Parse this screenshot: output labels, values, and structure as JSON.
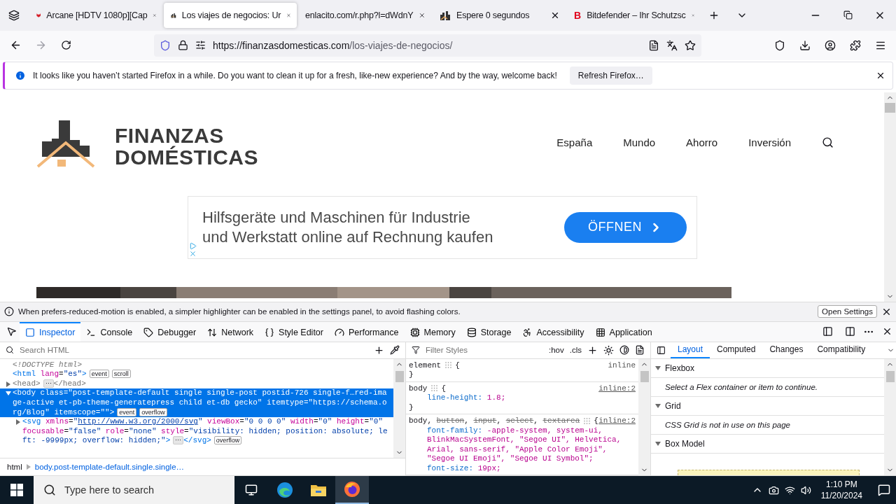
{
  "browser": {
    "tabs": [
      {
        "title": "Arcane [HDTV 1080p][Cap",
        "kind": "cat",
        "selected": false
      },
      {
        "title": "Los viajes de negocios: Ur",
        "kind": "buildings",
        "selected": true
      },
      {
        "title": "enlacito.com/r.php?l=dWdnY",
        "kind": "none",
        "selected": false
      },
      {
        "title": "Espere 0 segundos",
        "kind": "buildings",
        "selected": false
      },
      {
        "title": "Bitdefender – Ihr Schutzsc",
        "kind": "letter",
        "letter": "B",
        "selected": false
      }
    ],
    "url_host": "https://finanzasdomesticas.com",
    "url_path": "/los-viajes-de-negocios/",
    "notification": {
      "message": "It looks like you haven’t started Firefox in a while. Do you want to clean it up for a fresh, like-new experience? And by the way, welcome back!",
      "button": "Refresh Firefox…"
    }
  },
  "page": {
    "logo": [
      "FINANZAS",
      "DOMÉSTICAS"
    ],
    "menu": [
      "España",
      "Mundo",
      "Ahorro",
      "Inversión"
    ],
    "ad": {
      "lines": [
        "Hilfsgeräte und Maschinen für Industrie",
        "und Werkstatt online auf Rechnung kaufen"
      ],
      "button": "ÖFFNEN"
    }
  },
  "devtools": {
    "notice": {
      "message": "When prefers-reduced-motion is enabled, a simpler highlighter can be enabled in the settings panel, to avoid flashing colors.",
      "button": "Open Settings"
    },
    "tools": [
      {
        "label": "Inspector",
        "selected": true
      },
      {
        "label": "Console",
        "selected": false
      },
      {
        "label": "Debugger",
        "selected": false
      },
      {
        "label": "Network",
        "selected": false
      },
      {
        "label": "Style Editor",
        "selected": false
      },
      {
        "label": "Performance",
        "selected": false
      },
      {
        "label": "Memory",
        "selected": false
      },
      {
        "label": "Storage",
        "selected": false
      },
      {
        "label": "Accessibility",
        "selected": false
      },
      {
        "label": "Application",
        "selected": false
      }
    ],
    "html": {
      "placeholder": "Search HTML",
      "lines": [
        {
          "kind": "leaf",
          "selected": false,
          "segments": [
            {
              "kind": "doctype",
              "text": "<!DOCTYPE html>"
            }
          ]
        },
        {
          "kind": "leaf",
          "selected": false,
          "segments": [
            {
              "kind": "tag",
              "text": "<html"
            },
            {
              "kind": "attr",
              "text": " lang"
            },
            {
              "kind": "punct",
              "text": "="
            },
            {
              "kind": "value",
              "text": "\"es\""
            },
            {
              "kind": "tag",
              "text": ">"
            },
            {
              "kind": "badge",
              "text": "event"
            },
            {
              "kind": "badge",
              "text": "scroll"
            }
          ]
        },
        {
          "kind": "node",
          "expanded": false,
          "selected": false,
          "segments": [
            {
              "kind": "dim",
              "text": "<head>"
            },
            {
              "kind": "more",
              "text": "⋯"
            },
            {
              "kind": "dim",
              "text": "</head>"
            }
          ]
        },
        {
          "kind": "node",
          "expanded": true,
          "selected": true,
          "segments": [
            {
              "kind": "tag",
              "text": "<body"
            },
            {
              "kind": "attr",
              "text": " class"
            },
            {
              "kind": "punct",
              "text": "="
            },
            {
              "kind": "value",
              "text": "\"post-template-default single single-post postid-726 single-f…red-image-active et-pb-theme-generatepress child et-db gecko\""
            },
            {
              "kind": "attr",
              "text": " itemtype"
            },
            {
              "kind": "punct",
              "text": "="
            },
            {
              "kind": "value",
              "text": "\"https://schema.org/Blog\""
            },
            {
              "kind": "attr",
              "text": " itemscope"
            },
            {
              "kind": "punct",
              "text": "="
            },
            {
              "kind": "value",
              "text": "\"\""
            },
            {
              "kind": "tag",
              "text": ">"
            },
            {
              "kind": "badge",
              "text": "event"
            },
            {
              "kind": "badge",
              "text": "overflow"
            }
          ],
          "children": [
            {
              "kind": "node",
              "expanded": false,
              "selected": false,
              "segments": [
                {
                  "kind": "tag",
                  "text": "<svg"
                },
                {
                  "kind": "attr",
                  "text": " xmlns"
                },
                {
                  "kind": "punct",
                  "text": "="
                },
                {
                  "kind": "value",
                  "text": "\""
                },
                {
                  "kind": "link",
                  "text": "http://www.w3.org/2000/svg"
                },
                {
                  "kind": "value",
                  "text": "\""
                },
                {
                  "kind": "attr",
                  "text": " viewBox"
                },
                {
                  "kind": "punct",
                  "text": "="
                },
                {
                  "kind": "value",
                  "text": "\"0 0 0 0\""
                },
                {
                  "kind": "attr",
                  "text": " width"
                },
                {
                  "kind": "punct",
                  "text": "="
                },
                {
                  "kind": "value",
                  "text": "\"0\""
                },
                {
                  "kind": "attr",
                  "text": " height"
                },
                {
                  "kind": "punct",
                  "text": "="
                },
                {
                  "kind": "value",
                  "text": "\"0\""
                },
                {
                  "kind": "attr",
                  "text": " focusable"
                },
                {
                  "kind": "punct",
                  "text": "="
                },
                {
                  "kind": "value",
                  "text": "\"false\""
                },
                {
                  "kind": "attr",
                  "text": " role"
                },
                {
                  "kind": "punct",
                  "text": "="
                },
                {
                  "kind": "value",
                  "text": "\"none\""
                },
                {
                  "kind": "attr",
                  "text": " style"
                },
                {
                  "kind": "punct",
                  "text": "="
                },
                {
                  "kind": "value",
                  "text": "\"visibility: hidden; position: absolute; left: -9999px; overflow: hidden;\""
                },
                {
                  "kind": "tag",
                  "text": ">"
                },
                {
                  "kind": "more",
                  "text": "⋯"
                },
                {
                  "kind": "tag",
                  "text": "</svg>"
                },
                {
                  "kind": "badge",
                  "text": "overflow"
                }
              ]
            }
          ]
        }
      ]
    },
    "breadcrumb": [
      {
        "text": "html",
        "selected": false
      },
      {
        "text": "body.post-template-default.single.single…",
        "selected": true
      }
    ],
    "styles": {
      "placeholder": "Filter Styles",
      "toggles": [
        ":hov",
        ".cls"
      ],
      "rules": [
        {
          "selector": [
            {
              "text": "element",
              "struck": false
            }
          ],
          "open": "{",
          "close": "}",
          "source": "inline",
          "linked": false
        },
        {
          "selector": [
            {
              "text": "body",
              "struck": false
            }
          ],
          "open": "{",
          "close": "}",
          "source": "inline:2",
          "linked": true,
          "declarations": [
            {
              "name": "line-height:",
              "value": "1.8;"
            }
          ]
        },
        {
          "selector": [
            {
              "text": "body, ",
              "struck": false
            },
            {
              "text": "button",
              "struck": true
            },
            {
              "text": ", ",
              "struck": false
            },
            {
              "text": "input",
              "struck": true
            },
            {
              "text": ", ",
              "struck": false
            },
            {
              "text": "select",
              "struck": true
            },
            {
              "text": ", ",
              "struck": false
            },
            {
              "text": "textarea",
              "struck": true
            }
          ],
          "open": "{",
          "source": "inline:2",
          "linked": true,
          "declarations": [
            {
              "name": "font-family:",
              "value": "-apple-system, system-ui, BlinkMacSystemFont, \"Segoe UI\", Helvetica, Arial, sans-serif, \"Apple Color Emoji\", \"Segoe UI Emoji\", \"Segoe UI Symbol\";"
            },
            {
              "name": "font-size:",
              "value": "19px;"
            }
          ]
        }
      ]
    },
    "sidebar": {
      "tabs": [
        {
          "label": "Layout",
          "selected": true
        },
        {
          "label": "Computed",
          "selected": false
        },
        {
          "label": "Changes",
          "selected": false
        },
        {
          "label": "Compatibility",
          "selected": false
        }
      ],
      "sections": [
        {
          "title": "Flexbox",
          "expanded": true,
          "message": "Select a Flex container or item to continue."
        },
        {
          "title": "Grid",
          "expanded": true,
          "message": "CSS Grid is not in use on this page"
        },
        {
          "title": "Box Model",
          "expanded": true
        }
      ]
    }
  },
  "taskbar": {
    "search_placeholder": "Type here to search",
    "time": "1:10 PM",
    "date": "11/20/2024",
    "apps": [
      {
        "kind": "edge",
        "selected": false
      },
      {
        "kind": "explorer",
        "selected": false
      },
      {
        "kind": "firefox",
        "selected": true
      }
    ]
  }
}
